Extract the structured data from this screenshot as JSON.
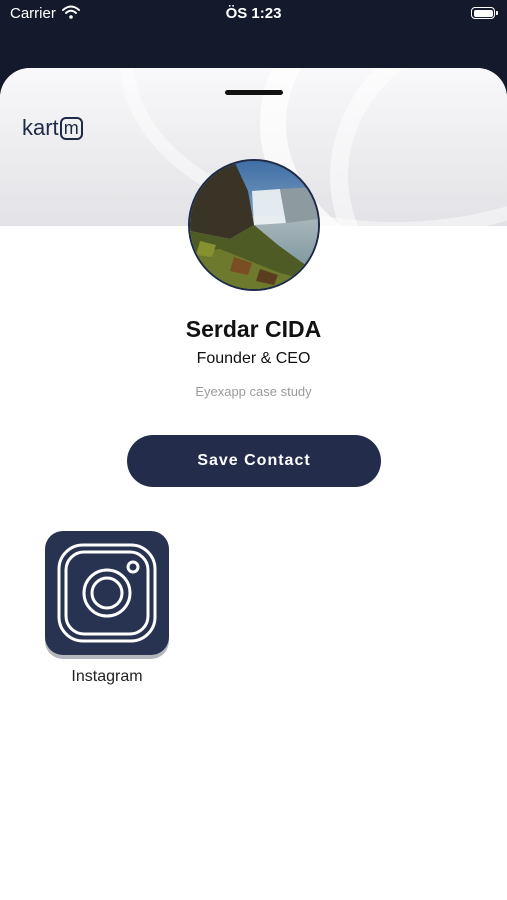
{
  "status_bar": {
    "carrier": "Carrier",
    "time": "ÖS 1:23"
  },
  "brand": {
    "logo_text": "kart",
    "logo_box_letter": "m"
  },
  "profile": {
    "name": "Serdar CIDA",
    "title": "Founder & CEO",
    "company": "Eyexapp case study"
  },
  "actions": {
    "save_contact_label": "Save Contact"
  },
  "social_links": [
    {
      "label": "Instagram",
      "icon": "instagram-icon"
    }
  ],
  "colors": {
    "background_dark": "#141a2c",
    "primary": "#232c4a",
    "tile": "#283352",
    "subtle_text": "#9a9a9a"
  }
}
